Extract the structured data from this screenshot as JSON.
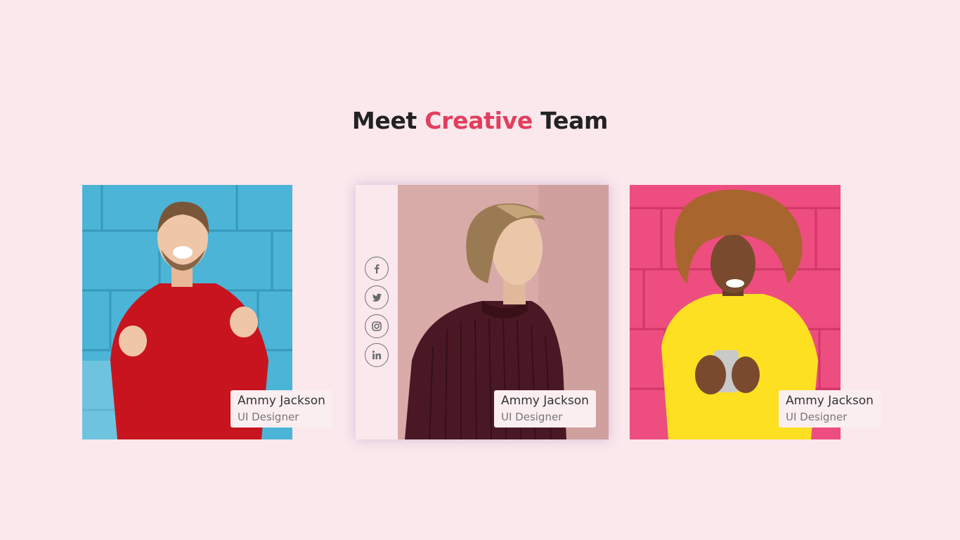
{
  "section": {
    "title_before": "Meet",
    "title_accent": "Creative",
    "title_after": "Team"
  },
  "colors": {
    "background": "#fae8ec",
    "accent": "#e23e5e",
    "heading": "#222222"
  },
  "team": [
    {
      "name": "Ammy Jackson",
      "role": "UI Designer"
    },
    {
      "name": "Ammy Jackson",
      "role": "UI Designer"
    },
    {
      "name": "Ammy Jackson",
      "role": "UI Designer"
    }
  ],
  "social_icons": [
    "facebook-icon",
    "twitter-icon",
    "instagram-icon",
    "linkedin-icon"
  ]
}
